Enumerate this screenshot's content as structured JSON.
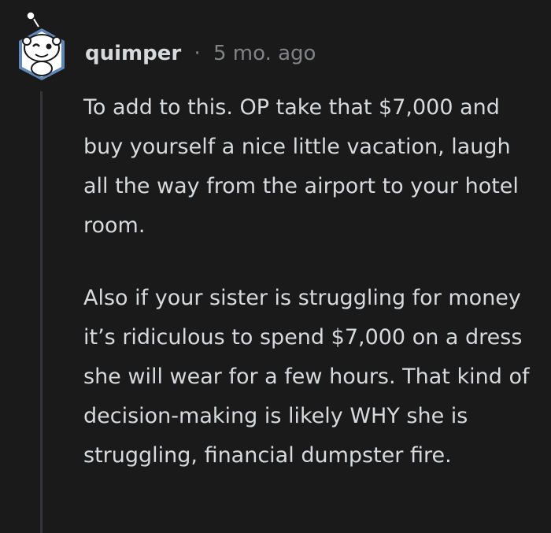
{
  "comment": {
    "author": "quimper",
    "separator": "·",
    "timestamp": "5 mo. ago",
    "paragraphs": [
      "To add to this. OP take that $7,000 and buy yourself a nice little vacation, laugh all the way from the airport to your hotel room.",
      "Also if your sister is struggling for money it’s ridiculous to spend $7,000 on a dress she will wear for a few hours. That kind of decision-making is likely WHY she is struggling, financial dumpster fire."
    ]
  },
  "icons": {
    "avatar": "snoo-avatar-icon"
  },
  "colors": {
    "background": "#1a1a1b",
    "text": "#d7dadc",
    "meta": "#818384",
    "thread_line": "#343536",
    "avatar_border": "#5f87b8"
  }
}
